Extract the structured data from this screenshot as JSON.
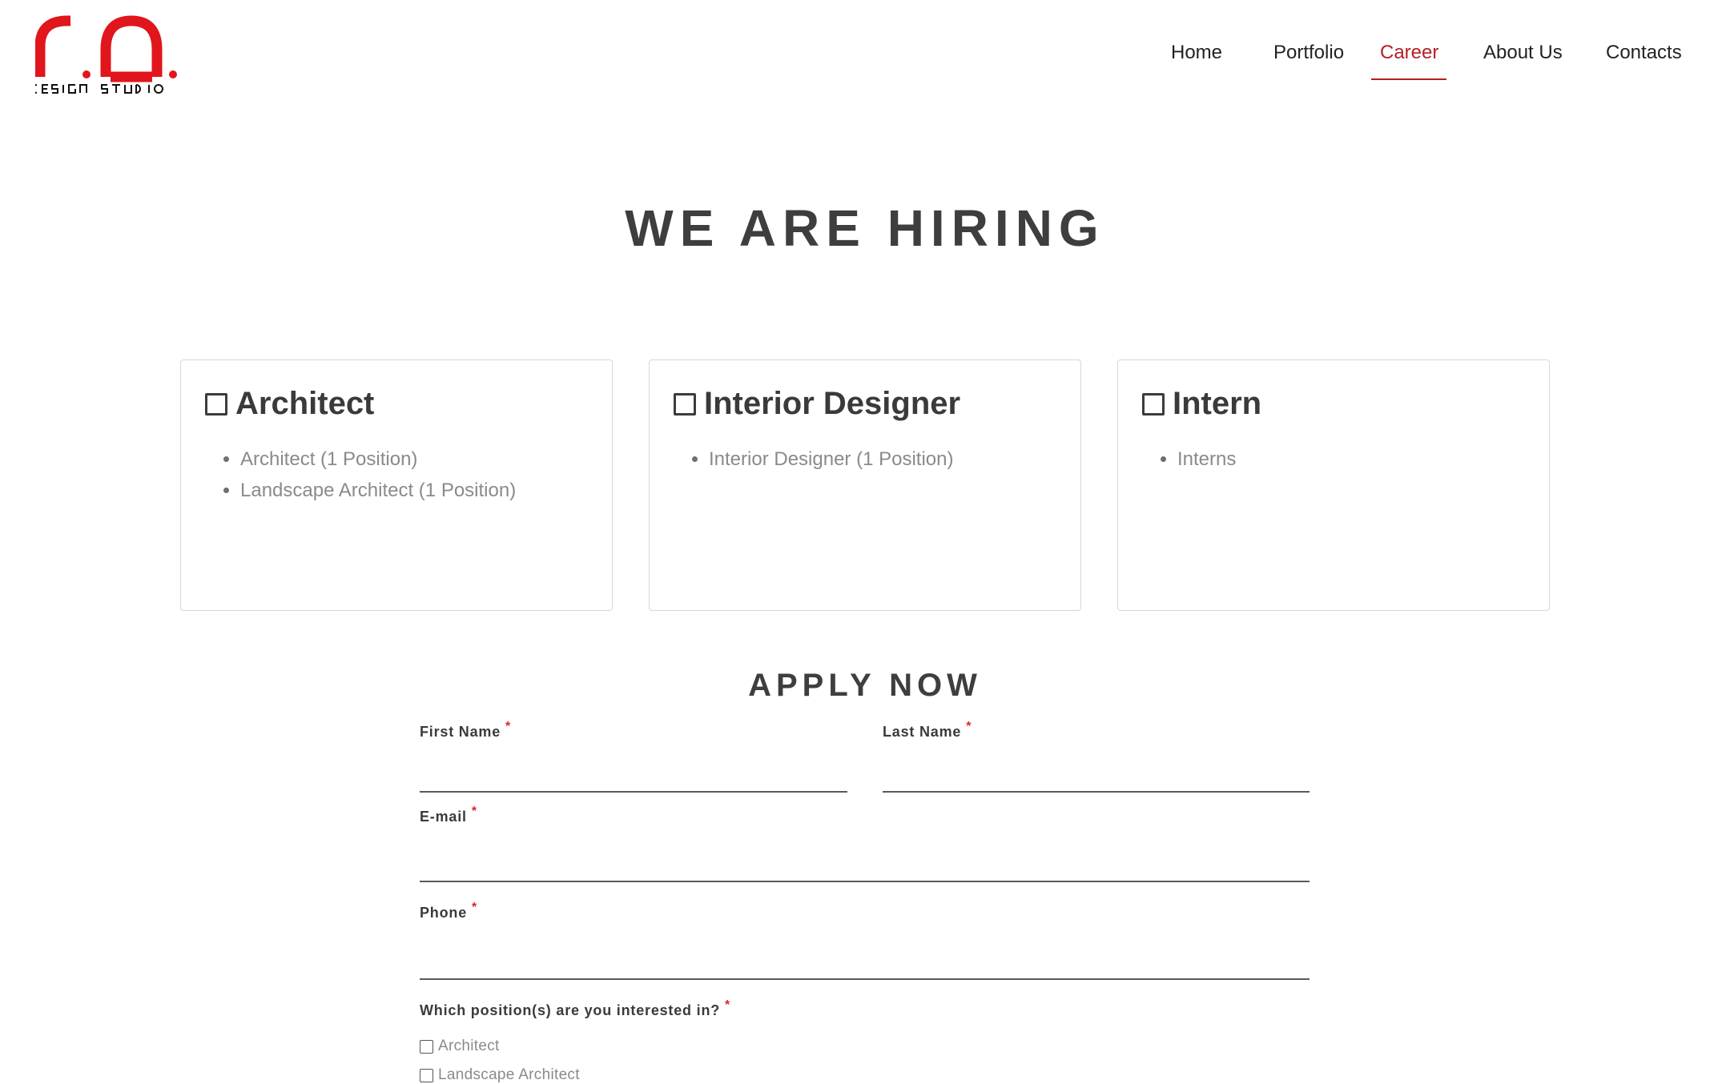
{
  "brand": {
    "logo_text": "r.a.",
    "logo_subtext": "DESIGN STUDIO",
    "accent_color": "#e1151c"
  },
  "nav": {
    "items": [
      {
        "label": "Home",
        "active": false
      },
      {
        "label": "Portfolio",
        "active": false
      },
      {
        "label": "Career",
        "active": true
      },
      {
        "label": "About Us",
        "active": false
      },
      {
        "label": "Contacts",
        "active": false
      }
    ],
    "active_color": "#b51f24"
  },
  "hiring": {
    "title": "WE ARE HIRING",
    "cards": [
      {
        "title": "Architect",
        "icon": "checkbox-icon",
        "positions": [
          "Architect (1 Position)",
          "Landscape Architect (1 Position)"
        ]
      },
      {
        "title": "Interior Designer",
        "icon": "checkbox-icon",
        "positions": [
          "Interior Designer (1 Position)"
        ]
      },
      {
        "title": "Intern",
        "icon": "checkbox-icon",
        "positions": [
          "Interns"
        ]
      }
    ]
  },
  "apply": {
    "title": "APPLY NOW",
    "required_mark": "*",
    "first_name_label": "First Name",
    "first_name_value": "",
    "last_name_label": "Last Name",
    "last_name_value": "",
    "email_label": "E-mail",
    "email_value": "",
    "phone_label": "Phone",
    "phone_value": "",
    "position_question": "Which position(s) are you interested in?",
    "position_options": [
      {
        "label": "Architect",
        "checked": false
      },
      {
        "label": "Landscape Architect",
        "checked": false
      }
    ]
  }
}
